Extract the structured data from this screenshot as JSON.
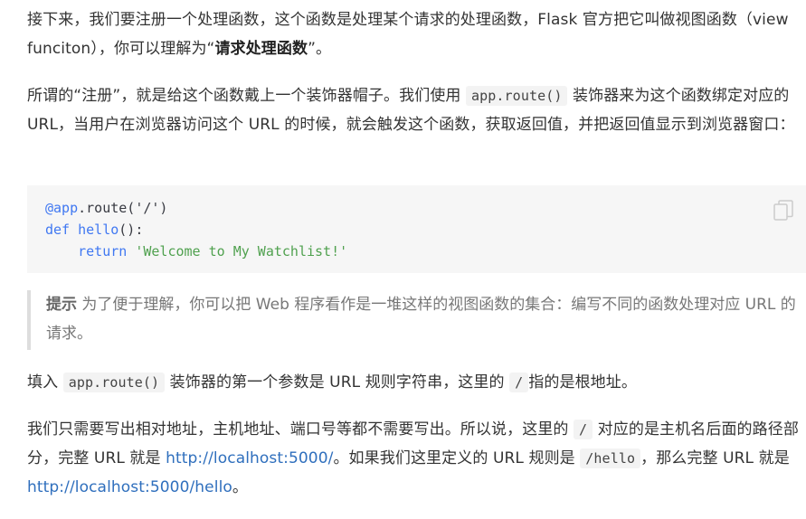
{
  "para1": {
    "text1": "接下来，我们要注册一个处理函数，这个函数是处理某个请求的处理函数，Flask 官方把它叫做视图函数（view funciton），你可以理解为“",
    "bold": "请求处理函数",
    "text2": "”。"
  },
  "para2": {
    "text1": "所谓的“注册”，就是给这个函数戴上一个装饰器帽子。我们使用 ",
    "code": "app.route()",
    "text2": " 装饰器来为这个函数绑定对应的 URL，当用户在浏览器访问这个 URL 的时候，就会触发这个函数，获取返回值，并把返回值显示到浏览器窗口："
  },
  "code_block": {
    "line1": {
      "deco": "@app",
      "rest": ".route('/')"
    },
    "line2": {
      "kw": "def",
      "fn": "hello",
      "rest": "():"
    },
    "line3": {
      "indent": "    ",
      "kw": "return",
      "str": "'Welcome to My Watchlist!'"
    }
  },
  "note": {
    "label": "提示",
    "text": " 为了便于理解，你可以把 Web 程序看作是一堆这样的视图函数的集合：编写不同的函数处理对应 URL 的请求。"
  },
  "para3": {
    "text1": "填入 ",
    "code1": "app.route()",
    "text2": " 装饰器的第一个参数是 URL 规则字符串，这里的 ",
    "code2": "/",
    "text3": "指的是根地址。"
  },
  "para4": {
    "text1": "我们只需要写出相对地址，主机地址、端口号等都不需要写出。所以说，这里的 ",
    "code1": "/",
    "text2": " 对应的是主机名后面的路径部分，完整 URL 就是 ",
    "link1": "http://localhost:5000/",
    "text3": "。如果我们这里定义的 URL 规则是 ",
    "code2": "/hello",
    "text4": "，那么完整 URL 就是 ",
    "link2": "http://localhost:5000/hello",
    "text5": "。"
  },
  "icons": {
    "copy": "copy-icon"
  }
}
